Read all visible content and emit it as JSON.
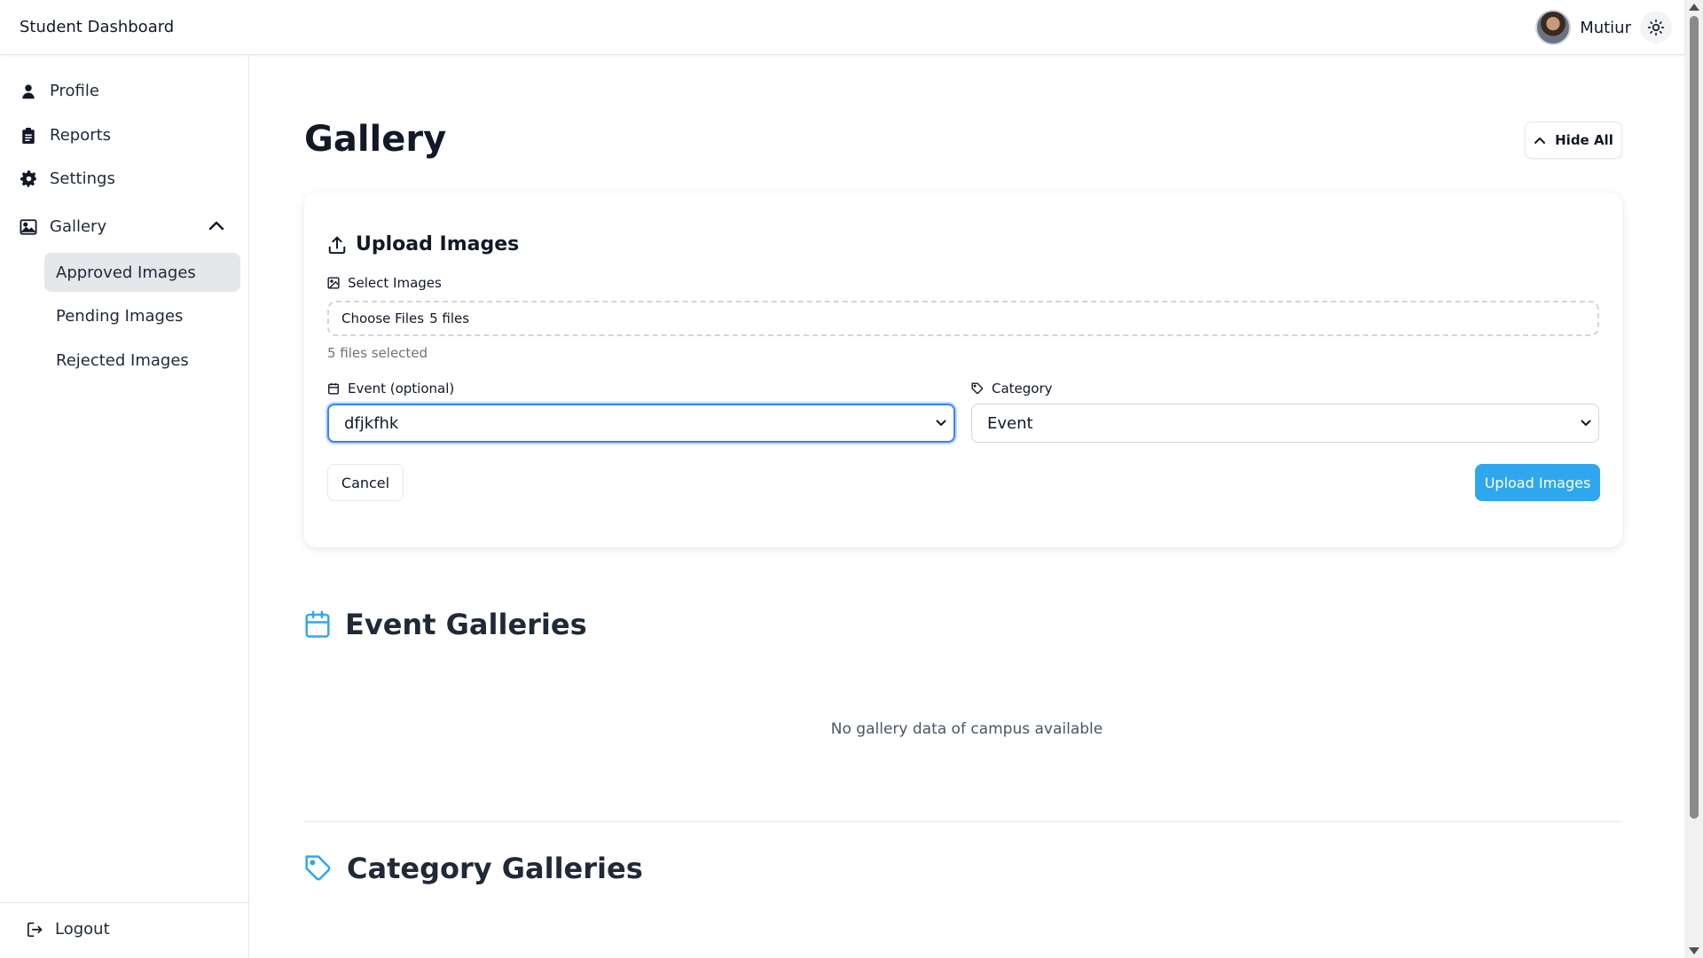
{
  "header": {
    "title": "Student Dashboard",
    "user_name": "Mutiur"
  },
  "sidebar": {
    "items": [
      {
        "label": "Profile",
        "icon": "user-icon"
      },
      {
        "label": "Reports",
        "icon": "clipboard-icon"
      },
      {
        "label": "Settings",
        "icon": "gear-icon"
      },
      {
        "label": "Gallery",
        "icon": "image-icon"
      }
    ],
    "gallery_subitems": [
      {
        "label": "Approved Images",
        "active": true
      },
      {
        "label": "Pending Images",
        "active": false
      },
      {
        "label": "Rejected Images",
        "active": false
      }
    ],
    "logout_label": "Logout"
  },
  "main": {
    "title": "Gallery",
    "hide_all_label": "Hide All",
    "upload": {
      "title": "Upload Images",
      "select_label": "Select Images",
      "choose_files_label": "Choose Files",
      "file_count_text": "5 files",
      "selected_hint": "5 files selected",
      "event_label": "Event (optional)",
      "event_value": "dfjkfhk",
      "category_label": "Category",
      "category_value": "Event",
      "cancel_label": "Cancel",
      "submit_label": "Upload Images"
    },
    "event_galleries_title": "Event Galleries",
    "empty_message": "No gallery data of campus available",
    "category_galleries_title": "Category Galleries"
  },
  "colors": {
    "accent": "#2fa7ee",
    "focus_ring": "#3b82f6",
    "active_bg": "#e5e7eb",
    "text": "#111827"
  }
}
